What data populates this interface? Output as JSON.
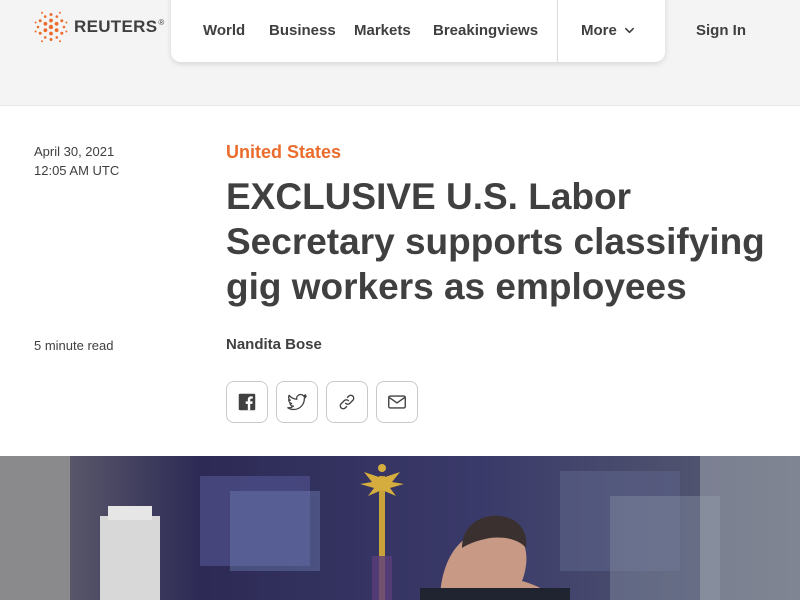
{
  "brand": {
    "name": "REUTERS",
    "trademark": "®",
    "accent_color": "#eb6c2c"
  },
  "nav": {
    "items": [
      {
        "label": "World"
      },
      {
        "label": "Business"
      },
      {
        "label": "Markets"
      },
      {
        "label": "Breakingviews"
      }
    ],
    "more_label": "More",
    "sign_in_label": "Sign In"
  },
  "article": {
    "date": "April 30, 2021",
    "time": "12:05 AM UTC",
    "read_time": "5 minute read",
    "section": "United States",
    "headline": "EXCLUSIVE U.S. Labor Secretary supports classifying gig workers as employees",
    "author": "Nandita Bose"
  },
  "share": {
    "icons": [
      "facebook-icon",
      "twitter-icon",
      "link-icon",
      "email-icon"
    ]
  }
}
